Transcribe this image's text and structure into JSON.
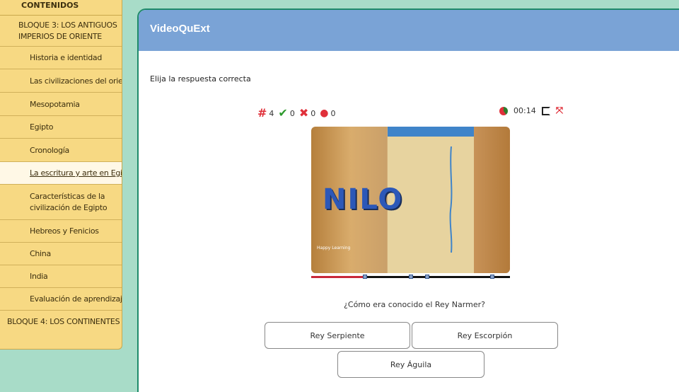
{
  "sidebar": {
    "header": "CONTENIDOS",
    "items": [
      {
        "label": "BLOQUE 3: LOS ANTIGUOS IMPERIOS DE ORIENTE",
        "type": "block"
      },
      {
        "label": "Historia e identidad",
        "type": "sub"
      },
      {
        "label": "Las civilizaciones del oriente",
        "type": "sub"
      },
      {
        "label": "Mesopotamia",
        "type": "sub"
      },
      {
        "label": "Egipto",
        "type": "sub"
      },
      {
        "label": "Cronología",
        "type": "sub"
      },
      {
        "label": "La escritura y arte en Egipto",
        "type": "sub",
        "active": true
      },
      {
        "label": "Características de la civilización de Egipto",
        "type": "sub"
      },
      {
        "label": "Hebreos y Fenicios",
        "type": "sub"
      },
      {
        "label": "China",
        "type": "sub"
      },
      {
        "label": "India",
        "type": "sub"
      },
      {
        "label": "Evaluación de aprendizajes",
        "type": "sub"
      },
      {
        "label": "BLOQUE 4: LOS CONTINENTES",
        "type": "block"
      }
    ]
  },
  "panel": {
    "title": "VideoQuExt",
    "instructions": "Elija la respuesta correcta"
  },
  "score": {
    "questions": "4",
    "correct": "0",
    "wrong": "0",
    "remaining": "0",
    "time": "00:14"
  },
  "video": {
    "title_text": "NILO",
    "logo_text": "Happy Learning",
    "progress_fraction": 0.27
  },
  "quiz": {
    "question": "¿Cómo era conocido el Rey Narmer?",
    "answers": [
      "Rey Serpiente",
      "Rey Escorpión",
      "Rey Águila"
    ]
  },
  "colors": {
    "header_blue": "#7aa3d6",
    "sidebar_yellow": "#f7d983",
    "background_mint": "#a8dcc8",
    "accent_red": "#c8283a",
    "correct_green": "#2d9a2d"
  }
}
